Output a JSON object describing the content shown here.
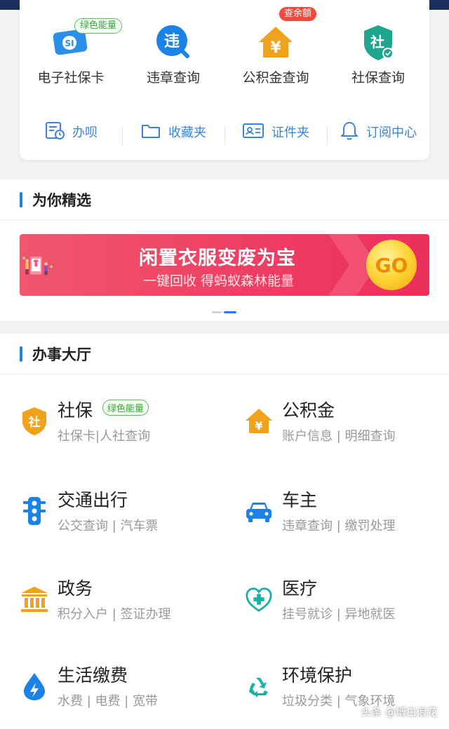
{
  "quick_services": [
    {
      "label": "电子社保卡",
      "icon": "social-security-card-icon",
      "badge": "绿色能量",
      "badge_type": "green"
    },
    {
      "label": "违章查询",
      "icon": "violation-query-icon",
      "badge": "",
      "badge_type": ""
    },
    {
      "label": "公积金查询",
      "icon": "housing-fund-icon",
      "badge": "查余额",
      "badge_type": "red"
    },
    {
      "label": "社保查询",
      "icon": "social-insurance-query-icon",
      "badge": "",
      "badge_type": ""
    }
  ],
  "tools": [
    {
      "label": "办呗",
      "icon": "task-list-icon"
    },
    {
      "label": "收藏夹",
      "icon": "folder-icon"
    },
    {
      "label": "证件夹",
      "icon": "id-card-icon"
    },
    {
      "label": "订阅中心",
      "icon": "bell-icon"
    }
  ],
  "featured": {
    "title": "为你精选",
    "banner": {
      "title": "闲置衣服变废为宝",
      "subtitle": "一键回收 得蚂蚁森林能量",
      "go_label": "GO"
    }
  },
  "hall": {
    "title": "办事大厅",
    "items": [
      {
        "title": "社保",
        "subtitle": "社保卡|人社查询",
        "badge": "绿色能量",
        "icon": "social-shield-icon"
      },
      {
        "title": "公积金",
        "subtitle": "账户信息 | 明细查询",
        "badge": "",
        "icon": "house-yuan-icon"
      },
      {
        "title": "交通出行",
        "subtitle": "公交查询 | 汽车票",
        "badge": "",
        "icon": "traffic-light-icon"
      },
      {
        "title": "车主",
        "subtitle": "违章查询 | 缴罚处理",
        "badge": "",
        "icon": "car-icon"
      },
      {
        "title": "政务",
        "subtitle": "积分入户 | 签证办理",
        "badge": "",
        "icon": "government-building-icon"
      },
      {
        "title": "医疗",
        "subtitle": "挂号就诊 | 异地就医",
        "badge": "",
        "icon": "medical-stethoscope-icon"
      },
      {
        "title": "生活缴费",
        "subtitle": "水费 | 电费 | 宽带",
        "badge": "",
        "icon": "water-drop-bolt-icon"
      },
      {
        "title": "环境保护",
        "subtitle": "垃圾分类 | 气象环境",
        "badge": "",
        "icon": "recycle-icon"
      }
    ]
  },
  "watermark": "头条 @博白浪花",
  "colors": {
    "accent_blue": "#1b82e6",
    "tool_blue": "#3b84d6",
    "icon_orange": "#f0a21c",
    "badge_green": "#3aa33a",
    "badge_red": "#ef4b3c",
    "banner_pink": "#ee3d62"
  }
}
